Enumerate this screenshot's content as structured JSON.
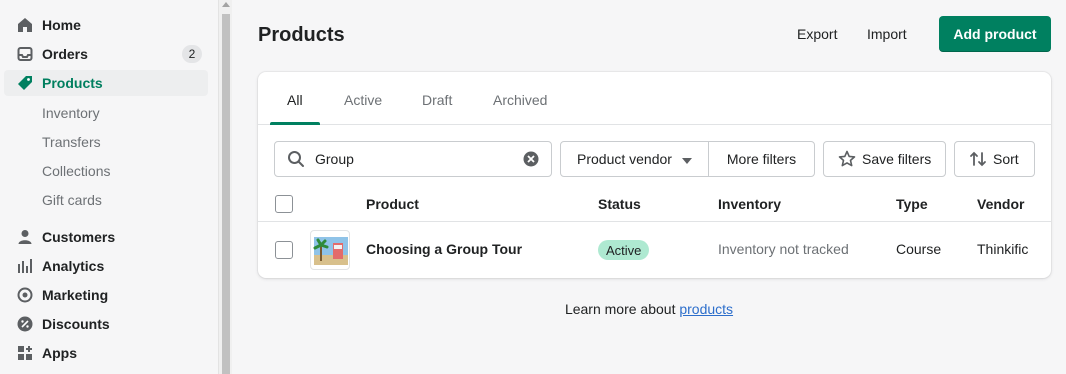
{
  "sidebar": {
    "items": [
      {
        "label": "Home",
        "icon": "home-icon"
      },
      {
        "label": "Orders",
        "icon": "orders-icon",
        "badge": "2"
      },
      {
        "label": "Products",
        "icon": "tag-icon",
        "active": true
      },
      {
        "label": "Customers",
        "icon": "person-icon"
      },
      {
        "label": "Analytics",
        "icon": "bar-chart-icon"
      },
      {
        "label": "Marketing",
        "icon": "target-icon"
      },
      {
        "label": "Discounts",
        "icon": "discount-icon"
      },
      {
        "label": "Apps",
        "icon": "apps-icon"
      }
    ],
    "subitems": [
      "Inventory",
      "Transfers",
      "Collections",
      "Gift cards"
    ]
  },
  "header": {
    "title": "Products",
    "export_label": "Export",
    "import_label": "Import",
    "add_label": "Add product"
  },
  "tabs": [
    "All",
    "Active",
    "Draft",
    "Archived"
  ],
  "filters": {
    "search_value": "Group",
    "vendor_label": "Product vendor",
    "more_filters_label": "More filters",
    "save_filters_label": "Save filters",
    "sort_label": "Sort"
  },
  "table": {
    "columns": [
      "Product",
      "Status",
      "Inventory",
      "Type",
      "Vendor"
    ],
    "rows": [
      {
        "product": "Choosing a Group Tour",
        "status": "Active",
        "inventory": "Inventory not tracked",
        "type": "Course",
        "vendor": "Thinkific"
      }
    ]
  },
  "footer": {
    "learn_text": "Learn more about ",
    "learn_link": "products"
  },
  "colors": {
    "primary": "#008060",
    "active_badge": "#aee9d1",
    "link": "#2c6ecb"
  }
}
